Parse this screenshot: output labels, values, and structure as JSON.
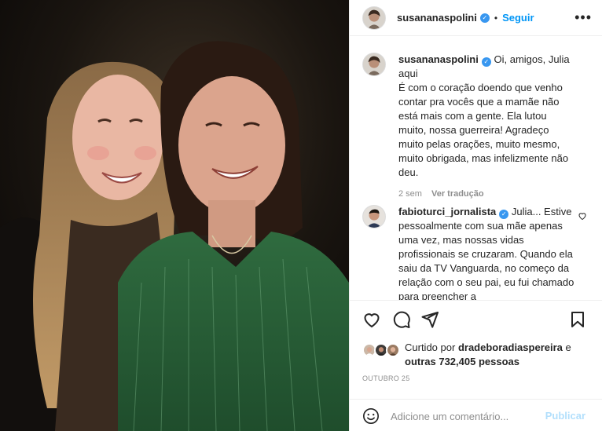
{
  "post": {
    "username": "susananaspolini",
    "follow_label": "Seguir",
    "separator": "•",
    "more_icon": "more-horizontal-icon"
  },
  "caption": {
    "username": "susananaspolini",
    "text": "Oi, amigos, Julia aqui É com o coração doendo que venho contar pra vocês que a mamãe não está mais com a gente. Ela lutou muito, nossa guerreira! Agradeço muito pelas orações, muito mesmo, muito obrigada, mas infelizmente não deu.",
    "line1": "Oi, amigos, Julia aqui",
    "line2": "É com o coração doendo que venho contar pra vocês que a mamãe não está mais com a gente. Ela lutou muito, nossa guerreira! Agradeço muito pelas orações, muito mesmo, muito obrigada, mas infelizmente não deu.",
    "time": "2 sem",
    "translate_label": "Ver tradução"
  },
  "comment": {
    "username": "fabioturci_jornalista",
    "text": "Julia... Estive pessoalmente com sua mãe apenas uma vez, mas nossas vidas profissionais se cruzaram. Quando ela saiu da TV Vanguarda, no começo da relação com o seu pai, eu fui chamado para preencher a"
  },
  "likes": {
    "prefix": "Curtido por",
    "user": "dradeboradiaspereira",
    "connector": "e",
    "others": "outras 732,405 pessoas"
  },
  "date": "OUTUBRO 25",
  "add_comment": {
    "placeholder": "Adicione um comentário...",
    "publish_label": "Publicar"
  },
  "colors": {
    "accent": "#0095f6",
    "verified": "#3897f0",
    "publish_disabled": "#b2dffc",
    "muted": "#8e8e8e"
  }
}
